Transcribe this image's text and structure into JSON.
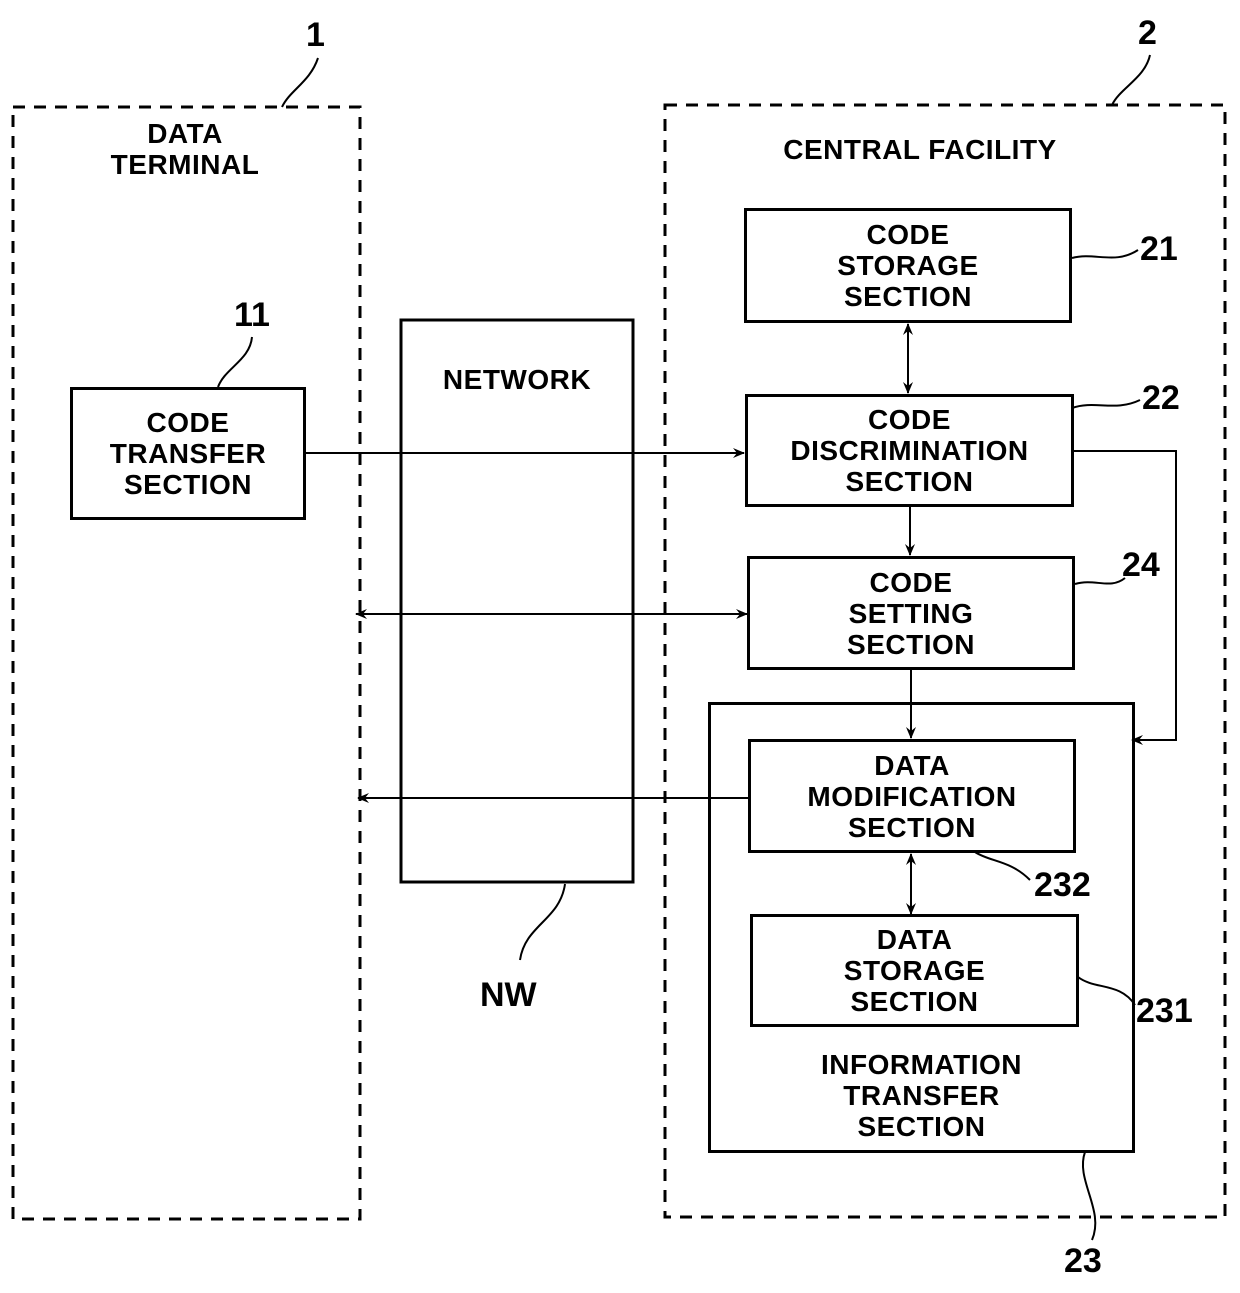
{
  "figure": {
    "data_terminal": {
      "ref": "1",
      "title": "DATA\nTERMINAL"
    },
    "central_facility": {
      "ref": "2",
      "title": "CENTRAL FACILITY"
    },
    "network": {
      "ref": "NW",
      "title": "NETWORK"
    },
    "blocks": {
      "code_transfer": {
        "ref": "11",
        "label": "CODE\nTRANSFER\nSECTION"
      },
      "code_storage": {
        "ref": "21",
        "label": "CODE\nSTORAGE\nSECTION"
      },
      "code_discrimination": {
        "ref": "22",
        "label": "CODE\nDISCRIMINATION\nSECTION"
      },
      "code_setting": {
        "ref": "24",
        "label": "CODE\nSETTING\nSECTION"
      },
      "information_transfer": {
        "ref": "23",
        "label": "INFORMATION\nTRANSFER\nSECTION"
      },
      "data_modification": {
        "ref": "232",
        "label": "DATA\nMODIFICATION\nSECTION"
      },
      "data_storage": {
        "ref": "231",
        "label": "DATA\nSTORAGE\nSECTION"
      }
    },
    "connections": [
      {
        "from": "code_transfer",
        "to": "code_discrimination",
        "direction": "forward"
      },
      {
        "from": "code_storage",
        "to": "code_discrimination",
        "direction": "bidirectional"
      },
      {
        "from": "code_discrimination",
        "to": "code_setting",
        "direction": "forward"
      },
      {
        "from": "code_discrimination",
        "to": "information_transfer",
        "direction": "forward"
      },
      {
        "from": "code_setting",
        "to": "data_terminal",
        "direction": "bidirectional"
      },
      {
        "from": "code_setting",
        "to": "data_modification",
        "direction": "forward"
      },
      {
        "from": "data_modification",
        "to": "data_terminal",
        "direction": "forward"
      },
      {
        "from": "data_modification",
        "to": "data_storage",
        "direction": "bidirectional"
      }
    ]
  }
}
